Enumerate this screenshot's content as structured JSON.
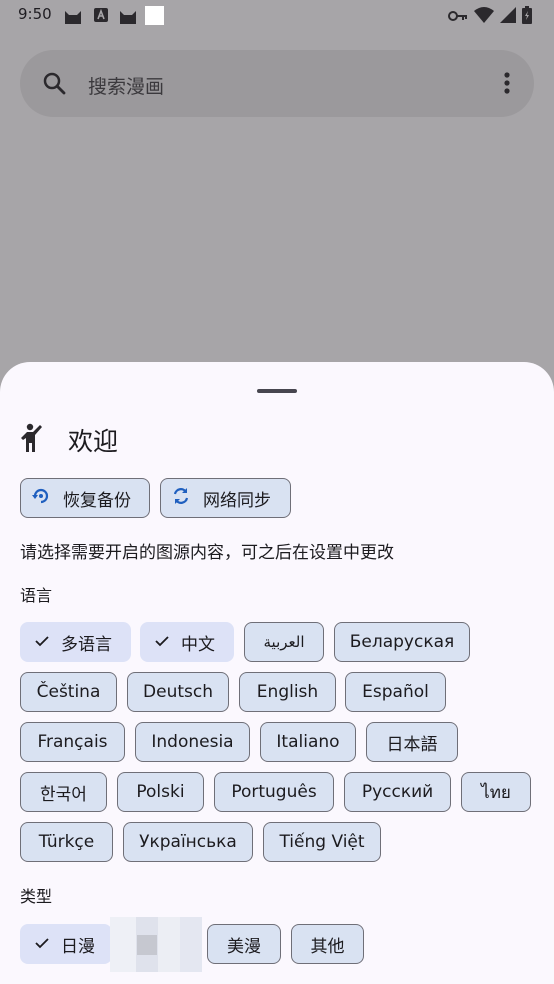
{
  "status_bar": {
    "time": "9:50",
    "icons": [
      "cat-icon",
      "text-a-icon",
      "cat-icon",
      "blank-square-icon"
    ],
    "right_icons": [
      "vpn-key-icon",
      "wifi-icon",
      "signal-icon",
      "battery-icon"
    ]
  },
  "search": {
    "placeholder": "搜索漫画"
  },
  "sheet": {
    "title": "欢迎",
    "actions": [
      {
        "label": "恢复备份",
        "icon": "restore-icon"
      },
      {
        "label": "网络同步",
        "icon": "sync-icon"
      }
    ],
    "description": "请选择需要开启的图源内容，可之后在设置中更改",
    "language_label": "语言",
    "languages": [
      {
        "label": "多语言",
        "selected": true
      },
      {
        "label": "中文",
        "selected": true
      },
      {
        "label": "العربية",
        "selected": false
      },
      {
        "label": "Беларуская",
        "selected": false
      },
      {
        "label": "Čeština",
        "selected": false
      },
      {
        "label": "Deutsch",
        "selected": false
      },
      {
        "label": "English",
        "selected": false
      },
      {
        "label": "Español",
        "selected": false
      },
      {
        "label": "Français",
        "selected": false
      },
      {
        "label": "Indonesia",
        "selected": false
      },
      {
        "label": "Italiano",
        "selected": false
      },
      {
        "label": "日本語",
        "selected": false
      },
      {
        "label": "한국어",
        "selected": false
      },
      {
        "label": "Polski",
        "selected": false
      },
      {
        "label": "Português",
        "selected": false
      },
      {
        "label": "Русский",
        "selected": false
      },
      {
        "label": "ไทย",
        "selected": false
      },
      {
        "label": "Türkçe",
        "selected": false
      },
      {
        "label": "Українська",
        "selected": false
      },
      {
        "label": "Tiếng Việt",
        "selected": false
      }
    ],
    "type_label": "类型",
    "types": [
      {
        "label": "日漫",
        "selected": true
      },
      {
        "label": "美漫",
        "selected": false
      },
      {
        "label": "其他",
        "selected": false
      }
    ]
  },
  "colors": {
    "scrim": "#a7a5a8",
    "sheet_bg": "#fbf8fe",
    "chip_bg": "#d9e2f2",
    "chip_selected_bg": "#dde2f7",
    "accent": "#1f5fbf"
  }
}
